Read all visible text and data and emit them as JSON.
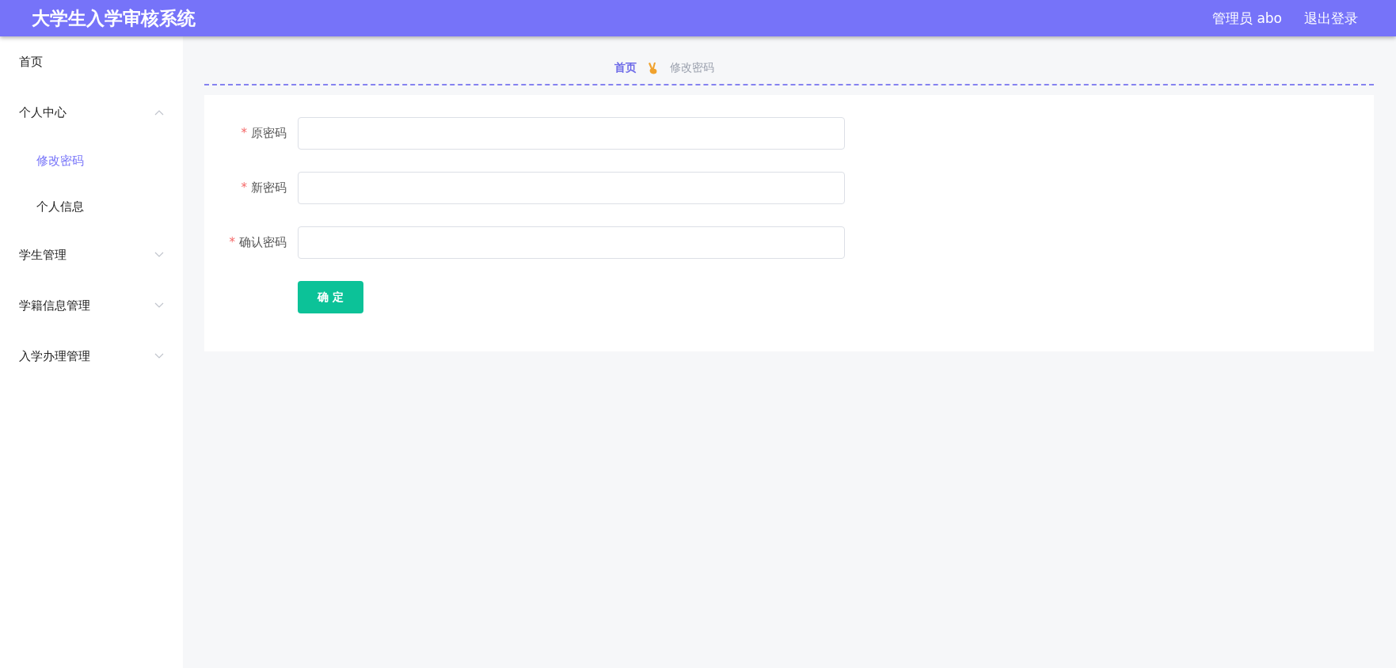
{
  "header": {
    "title": "大学生入学审核系统",
    "user": "管理员 abo",
    "logout": "退出登录"
  },
  "sidebar": {
    "items": [
      {
        "label": "首页",
        "selected": false
      },
      {
        "label": "个人中心",
        "expanded": true,
        "children": [
          {
            "label": "修改密码",
            "selected": true
          },
          {
            "label": "个人信息",
            "selected": false
          }
        ]
      },
      {
        "label": "学生管理",
        "expanded": false
      },
      {
        "label": "学籍信息管理",
        "expanded": false
      },
      {
        "label": "入学办理管理",
        "expanded": false
      }
    ]
  },
  "breadcrumb": [
    {
      "label": "首页",
      "selected": true
    },
    {
      "label": "修改密码",
      "selected": false
    }
  ],
  "form": {
    "fields": [
      {
        "mark": "*",
        "label": "原密码"
      },
      {
        "mark": "*",
        "label": "新密码"
      },
      {
        "mark": "*",
        "label": "确认密码"
      }
    ],
    "submit": "确 定"
  }
}
